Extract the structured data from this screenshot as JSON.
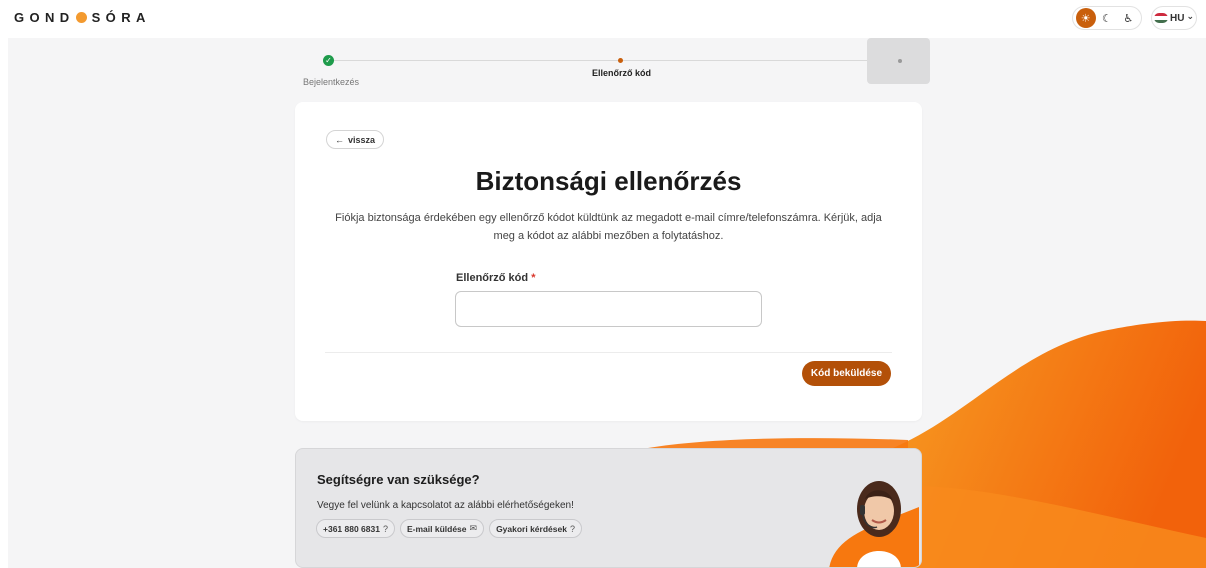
{
  "header": {
    "logo_left": "GOND",
    "logo_right": "SÓRA",
    "theme": {
      "light_icon": "☀",
      "dark_icon": "☾",
      "accessibility_icon": "♿",
      "active": "light",
      "accent": "#c95f0c"
    },
    "language": {
      "code": "HU",
      "chevron": "⌄",
      "flag_colors": [
        "#cd2a3e",
        "#ffffff",
        "#436f4d"
      ]
    }
  },
  "stepper": {
    "steps": [
      {
        "label": "Bejelentkezés",
        "status": "done",
        "check": "✓"
      },
      {
        "label": "Ellenőrző kód",
        "status": "active"
      },
      {
        "label": "",
        "status": "upcoming"
      }
    ]
  },
  "card": {
    "back_arrow": "←",
    "back_label": "vissza",
    "title": "Biztonsági ellenőrzés",
    "description": "Fiókja biztonsága érdekében egy ellenőrző kódot küldtünk az megadott e-mail címre/telefonszámra. Kérjük, adja meg a kódot az alábbi mezőben a folytatáshoz.",
    "field_label": "Ellenőrző kód",
    "required_mark": "*",
    "code_value": "",
    "submit_label": "Kód beküldése"
  },
  "help": {
    "title": "Segítségre van szüksége?",
    "description": "Vegye fel velünk a kapcsolatot az alábbi elérhetőségeken!",
    "links": [
      {
        "label": "+361 880 6831",
        "icon": "?"
      },
      {
        "label": "E-mail küldése",
        "icon": "✉"
      },
      {
        "label": "Gyakori kérdések",
        "icon": "?"
      }
    ]
  },
  "colors": {
    "brand_orange": "#f39a2f",
    "accent_brown": "#b35008",
    "success_green": "#1e9b4b",
    "wave_orange": "#f7780f"
  }
}
